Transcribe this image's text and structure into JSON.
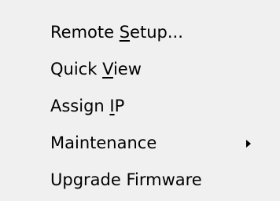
{
  "menu": {
    "items": [
      {
        "pre": "Remote ",
        "mnemonic": "S",
        "post": "etup...",
        "has_submenu": false
      },
      {
        "pre": "Quick ",
        "mnemonic": "V",
        "post": "iew",
        "has_submenu": false
      },
      {
        "pre": "Assign ",
        "mnemonic": "I",
        "post": "P",
        "has_submenu": false
      },
      {
        "pre": "Maintenance",
        "mnemonic": "",
        "post": "",
        "has_submenu": true,
        "submenu_icon": "arrow-right-icon"
      },
      {
        "pre": "Upgrade Firmware",
        "mnemonic": "",
        "post": "",
        "has_submenu": false
      }
    ]
  },
  "colors": {
    "background": "#f0f0f0",
    "text": "#000000"
  }
}
